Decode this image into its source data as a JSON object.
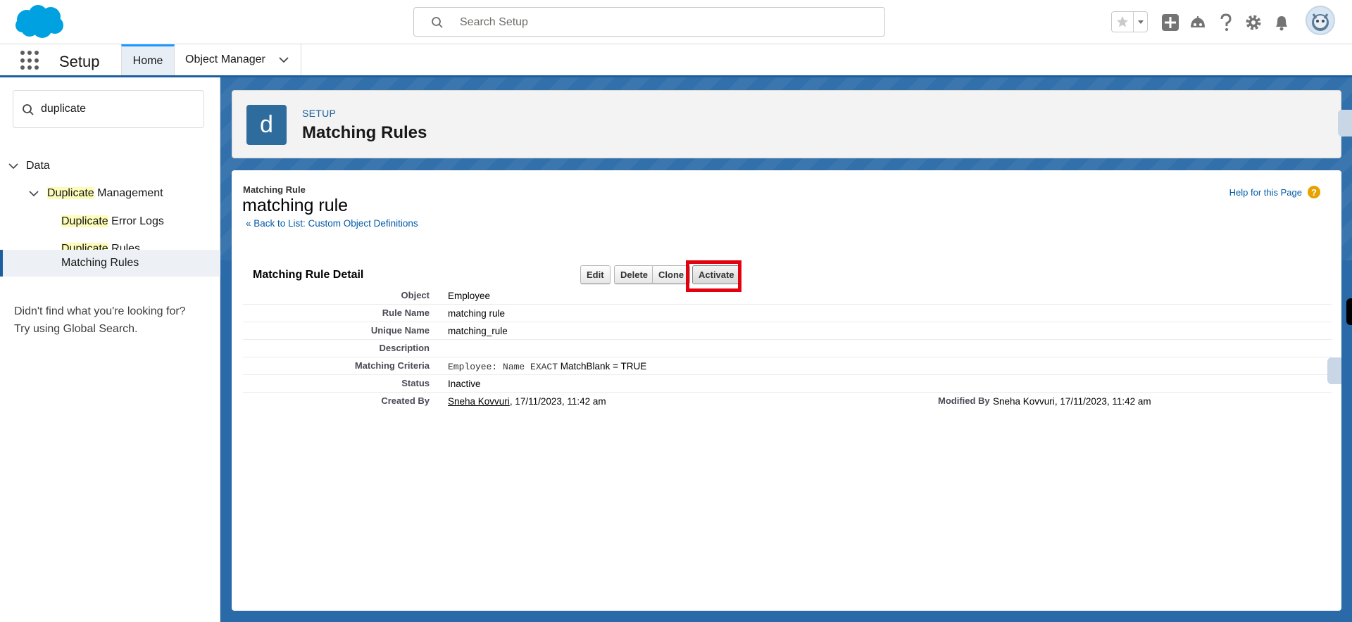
{
  "header": {
    "search_placeholder": "Search Setup"
  },
  "app_nav": {
    "app_name": "Setup",
    "tabs": [
      {
        "label": "Home"
      },
      {
        "label": "Object Manager"
      }
    ]
  },
  "sidebar": {
    "quick_find_value": "duplicate",
    "tree": {
      "data": "Data",
      "dup_mgmt_highlight": "Duplicate",
      "dup_mgmt_rest": " Management",
      "error_logs_highlight": "Duplicate",
      "error_logs_rest": " Error Logs",
      "rules_highlight": "Duplicate",
      "rules_rest": " Rules",
      "matching_rules": "Matching Rules"
    },
    "not_found_line1": "Didn't find what you're looking for?",
    "not_found_line2": "Try using Global Search."
  },
  "page_header": {
    "icon_letter": "d",
    "eyebrow": "SETUP",
    "title": "Matching Rules"
  },
  "record": {
    "type": "Matching Rule",
    "name": "matching rule",
    "back_link": "« Back to List: Custom Object Definitions",
    "help_link": "Help for this Page",
    "help_icon": "?"
  },
  "detail": {
    "title": "Matching Rule Detail",
    "buttons": {
      "edit": "Edit",
      "delete": "Delete",
      "clone": "Clone",
      "activate": "Activate"
    },
    "fields": {
      "object_label": "Object",
      "object_value": "Employee",
      "rule_name_label": "Rule Name",
      "rule_name_value": "matching rule",
      "unique_name_label": "Unique Name",
      "unique_name_value": "matching_rule",
      "description_label": "Description",
      "description_value": "",
      "criteria_label": "Matching Criteria",
      "criteria_mono": "Employee: Name EXACT",
      "criteria_rest": " MatchBlank = TRUE",
      "status_label": "Status",
      "status_value": "Inactive",
      "created_by_label": "Created By",
      "created_by_user": "Sneha Kovvuri",
      "created_by_date": ", 17/11/2023, 11:42 am",
      "modified_by_label": "Modified By",
      "modified_by_user": "Sneha Kovvuri",
      "modified_by_date": ", 17/11/2023, 11:42 am"
    }
  },
  "colors": {
    "brand_blue": "#1b5f9e",
    "highlight_box": "#e3000f",
    "search_highlight": "#fcfcb8"
  }
}
